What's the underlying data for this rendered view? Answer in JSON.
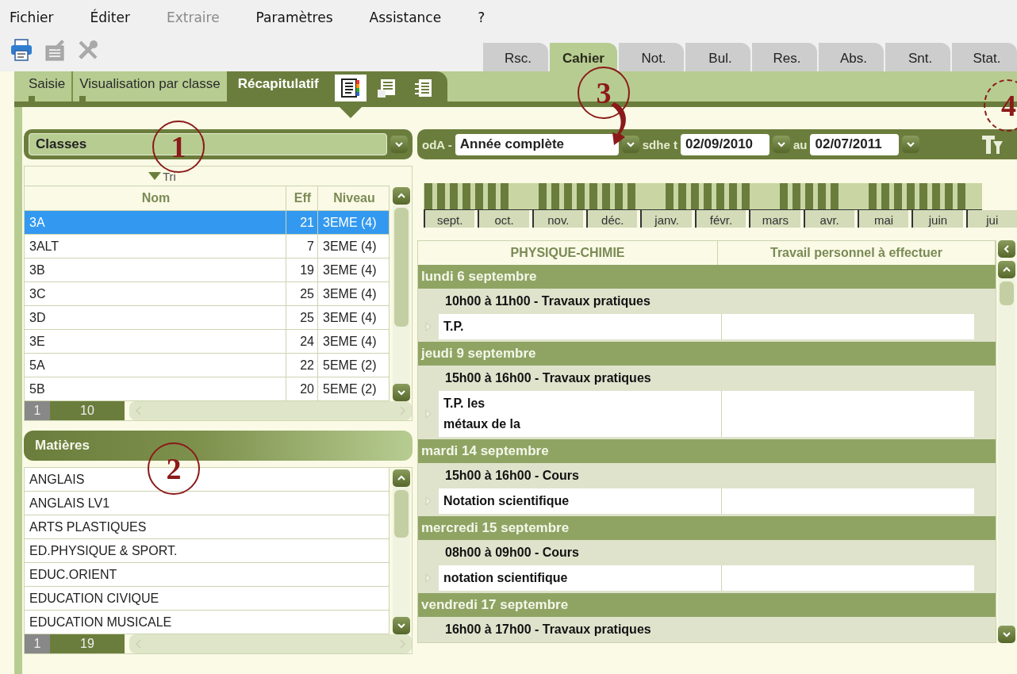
{
  "menu": [
    {
      "label": "Fichier",
      "disabled": false
    },
    {
      "label": "Éditer",
      "disabled": false
    },
    {
      "label": "Extraire",
      "disabled": true
    },
    {
      "label": "Paramètres",
      "disabled": false
    },
    {
      "label": "Assistance",
      "disabled": false
    },
    {
      "label": "?",
      "disabled": false
    }
  ],
  "toolbar": [
    {
      "kind": "printer",
      "disabled": false
    },
    {
      "kind": "form",
      "disabled": true
    },
    {
      "kind": "tools",
      "disabled": true
    }
  ],
  "module_tabs": [
    {
      "label": "Rsc.",
      "selected": false
    },
    {
      "label": "Cahier",
      "selected": true
    },
    {
      "label": "Not.",
      "selected": false
    },
    {
      "label": "Bul.",
      "selected": false
    },
    {
      "label": "Res.",
      "selected": false
    },
    {
      "label": "Abs.",
      "selected": false
    },
    {
      "label": "Snt.",
      "selected": false
    },
    {
      "label": "Stat.",
      "selected": false
    }
  ],
  "sub_tabs": [
    {
      "label": "Saisie",
      "selected": false
    },
    {
      "label": "Visualisation par classe",
      "selected": false
    },
    {
      "label": "Récapitulatif",
      "selected": true
    }
  ],
  "view_icons": [
    {
      "kind": "colored-list",
      "selected": true
    },
    {
      "kind": "document-edit",
      "selected": false
    },
    {
      "kind": "document-list",
      "selected": false
    }
  ],
  "classes_panel": {
    "selector": "Classes",
    "sort_label": "Tri",
    "columns": [
      "Nom",
      "Eff",
      "Niveau"
    ],
    "rows": [
      {
        "nom": "3A",
        "eff": "21",
        "niveau": "3EME (4)",
        "selected": true
      },
      {
        "nom": "3ALT",
        "eff": "7",
        "niveau": "3EME (4)",
        "selected": false
      },
      {
        "nom": "3B",
        "eff": "19",
        "niveau": "3EME (4)",
        "selected": false
      },
      {
        "nom": "3C",
        "eff": "25",
        "niveau": "3EME (4)",
        "selected": false
      },
      {
        "nom": "3D",
        "eff": "25",
        "niveau": "3EME (4)",
        "selected": false
      },
      {
        "nom": "3E",
        "eff": "24",
        "niveau": "3EME (4)",
        "selected": false
      },
      {
        "nom": "5A",
        "eff": "22",
        "niveau": "5EME (2)",
        "selected": false
      },
      {
        "nom": "5B",
        "eff": "20",
        "niveau": "5EME (2)",
        "selected": false
      }
    ],
    "pager": {
      "first": "1",
      "count": "10"
    }
  },
  "subjects_panel": {
    "title": "Matières",
    "items": [
      {
        "label": "ANGLAIS",
        "selected": false
      },
      {
        "label": "ANGLAIS LV1",
        "selected": false
      },
      {
        "label": "ARTS PLASTIQUES",
        "selected": false
      },
      {
        "label": "ED.PHYSIQUE & SPORT.",
        "selected": false
      },
      {
        "label": "EDUC.ORIENT",
        "selected": false
      },
      {
        "label": "EDUCATION CIVIQUE",
        "selected": false
      },
      {
        "label": "EDUCATION MUSICALE",
        "selected": false
      }
    ],
    "pager": {
      "first": "1",
      "count": "19"
    }
  },
  "period": {
    "prefix": "odA -",
    "value": "Année complète",
    "from_label": "sdhe t",
    "from": "02/09/2010",
    "to_label": "au",
    "to": "02/07/2011"
  },
  "timeline": {
    "months": [
      "sept.",
      "oct.",
      "nov.",
      "déc.",
      "janv.",
      "févr.",
      "mars",
      "avr.",
      "mai",
      "juin",
      "jui"
    ]
  },
  "journal": {
    "columns": [
      "PHYSIQUE-CHIMIE",
      "Travail personnel à effectuer"
    ],
    "days": [
      {
        "date": "lundi 6 septembre",
        "sessions": [
          {
            "time": "10h00 à 11h00 - Travaux pratiques",
            "content": [
              "T.P."
            ]
          }
        ]
      },
      {
        "date": "jeudi 9 septembre",
        "sessions": [
          {
            "time": "15h00 à 16h00 - Travaux pratiques",
            "content": [
              "T.P. les",
              "métaux de la"
            ]
          }
        ]
      },
      {
        "date": "mardi 14 septembre",
        "sessions": [
          {
            "time": "15h00 à 16h00 - Cours",
            "content": [
              "Notation scientifique"
            ]
          }
        ]
      },
      {
        "date": "mercredi 15 septembre",
        "sessions": [
          {
            "time": "08h00 à 09h00 - Cours",
            "content": [
              "notation scientifique"
            ]
          }
        ]
      },
      {
        "date": "vendredi 17 septembre",
        "sessions": [
          {
            "time": "16h00 à 17h00 - Travaux pratiques"
          }
        ]
      }
    ]
  },
  "callouts": [
    {
      "label": "1",
      "kind": "solid",
      "arrow": false
    },
    {
      "label": "2",
      "kind": "solid",
      "arrow": false
    },
    {
      "label": "3",
      "kind": "solid",
      "arrow": true
    },
    {
      "label": "4",
      "kind": "dashed",
      "arrow": false
    }
  ]
}
